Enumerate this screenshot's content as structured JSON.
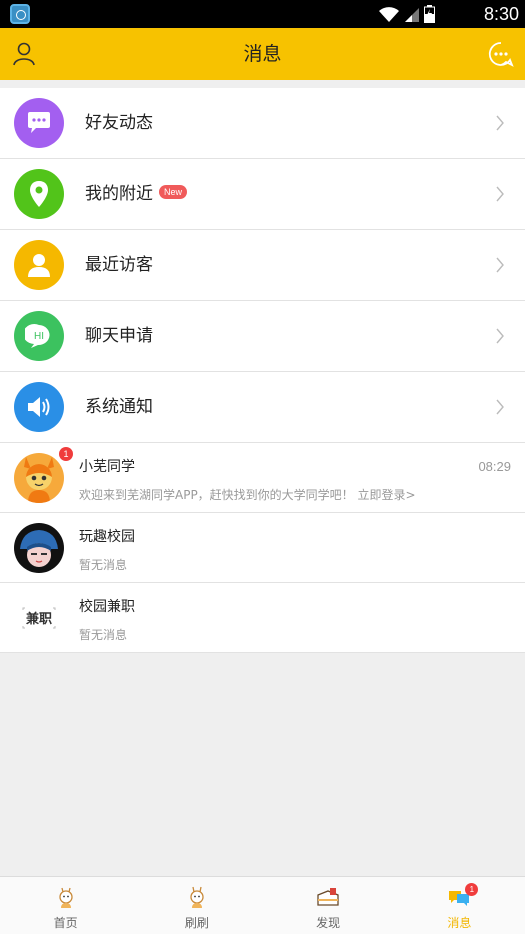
{
  "status_bar": {
    "time": "8:30"
  },
  "header": {
    "title": "消息"
  },
  "menu": [
    {
      "label": "好友动态",
      "icon": "chat-bubble-icon",
      "color": "#a35ff0"
    },
    {
      "label": "我的附近",
      "badge": "New",
      "icon": "location-pin-icon",
      "color": "#52c41a"
    },
    {
      "label": "最近访客",
      "icon": "person-icon",
      "color": "#f5b800"
    },
    {
      "label": "聊天申请",
      "icon": "hi-bubble-icon",
      "icon_text": "HI",
      "color": "#3cc25f"
    },
    {
      "label": "系统通知",
      "icon": "speaker-icon",
      "color": "#2a8fe6"
    }
  ],
  "messages": [
    {
      "name": "小芜同学",
      "preview": "欢迎来到芜湖同学APP，赶快找到你的大学同学吧！ 立即登录>",
      "time": "08:29",
      "unread": "1"
    },
    {
      "name": "玩趣校园",
      "preview": "暂无消息"
    },
    {
      "name": "校园兼职",
      "preview": "暂无消息",
      "avatar_text": "兼职"
    }
  ],
  "tabs": [
    {
      "label": "首页"
    },
    {
      "label": "刷刷"
    },
    {
      "label": "发现"
    },
    {
      "label": "消息",
      "badge": "1",
      "active": true
    }
  ],
  "colors": {
    "header_bg": "#f7c200",
    "active_tab": "#f2b600",
    "badge_red": "#f03c3c"
  }
}
